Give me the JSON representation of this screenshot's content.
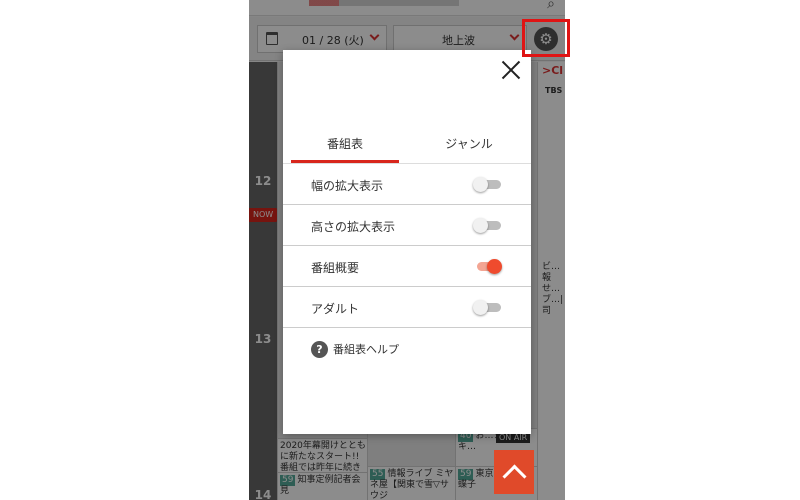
{
  "header": {
    "search_icon": "search-icon"
  },
  "toolbar": {
    "date_label": "01 / 28 (火)",
    "channel_label": "地上波",
    "settings_icon": "gear-icon"
  },
  "grid": {
    "hours": [
      "12",
      "13",
      "14"
    ],
    "now_label": "NOW",
    "channel_name": ">Cl",
    "channel_sub": "TBS",
    "cells": [
      {
        "text": "2020年幕開けとともに新たなスタート!! 番組では昨年に続き"
      },
      {
        "num": "59",
        "text": "知事定例記者会見"
      },
      {
        "num": "55",
        "text": "情報ライブ ミヤネ屋【関東で雪▽サウジ"
      },
      {
        "num": "59",
        "text": "東京…検事…蝶子"
      },
      {
        "num": "40",
        "text": "お…シ…ッキ…"
      }
    ],
    "on_air": "ON AIR",
    "side_text": "ビ…報せ…ブ…|司"
  },
  "modal": {
    "tabs": [
      {
        "label": "番組表",
        "active": true
      },
      {
        "label": "ジャンル",
        "active": false
      }
    ],
    "settings": [
      {
        "label": "幅の拡大表示",
        "on": false
      },
      {
        "label": "高さの拡大表示",
        "on": false
      },
      {
        "label": "番組概要",
        "on": true
      },
      {
        "label": "アダルト",
        "on": false
      }
    ],
    "help_icon": "?",
    "help_label": "番組表ヘルプ"
  },
  "colors": {
    "accent": "#d8261c",
    "toggle_on": "#ef4b2e",
    "highlight": "#e01414"
  }
}
